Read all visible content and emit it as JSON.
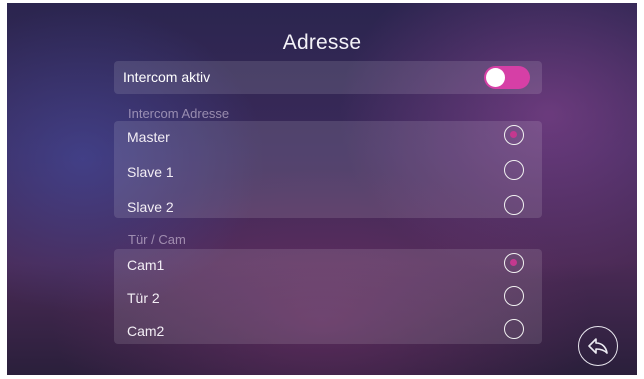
{
  "header": {
    "title": "Adresse"
  },
  "intercom": {
    "label": "Intercom aktiv",
    "enabled": true,
    "accent": "#d63fa6"
  },
  "address_section": {
    "label": "Intercom Adresse",
    "options": [
      {
        "label": "Master",
        "selected": true
      },
      {
        "label": "Slave 1",
        "selected": false
      },
      {
        "label": "Slave 2",
        "selected": false
      }
    ]
  },
  "door_section": {
    "label": "Tür / Cam",
    "options": [
      {
        "label": "Cam1",
        "selected": true
      },
      {
        "label": "Tür 2",
        "selected": false
      },
      {
        "label": "Cam2",
        "selected": false
      }
    ]
  },
  "back": {
    "icon": "back-arrow-icon"
  },
  "colors": {
    "selected_dot": "#c4388f"
  }
}
